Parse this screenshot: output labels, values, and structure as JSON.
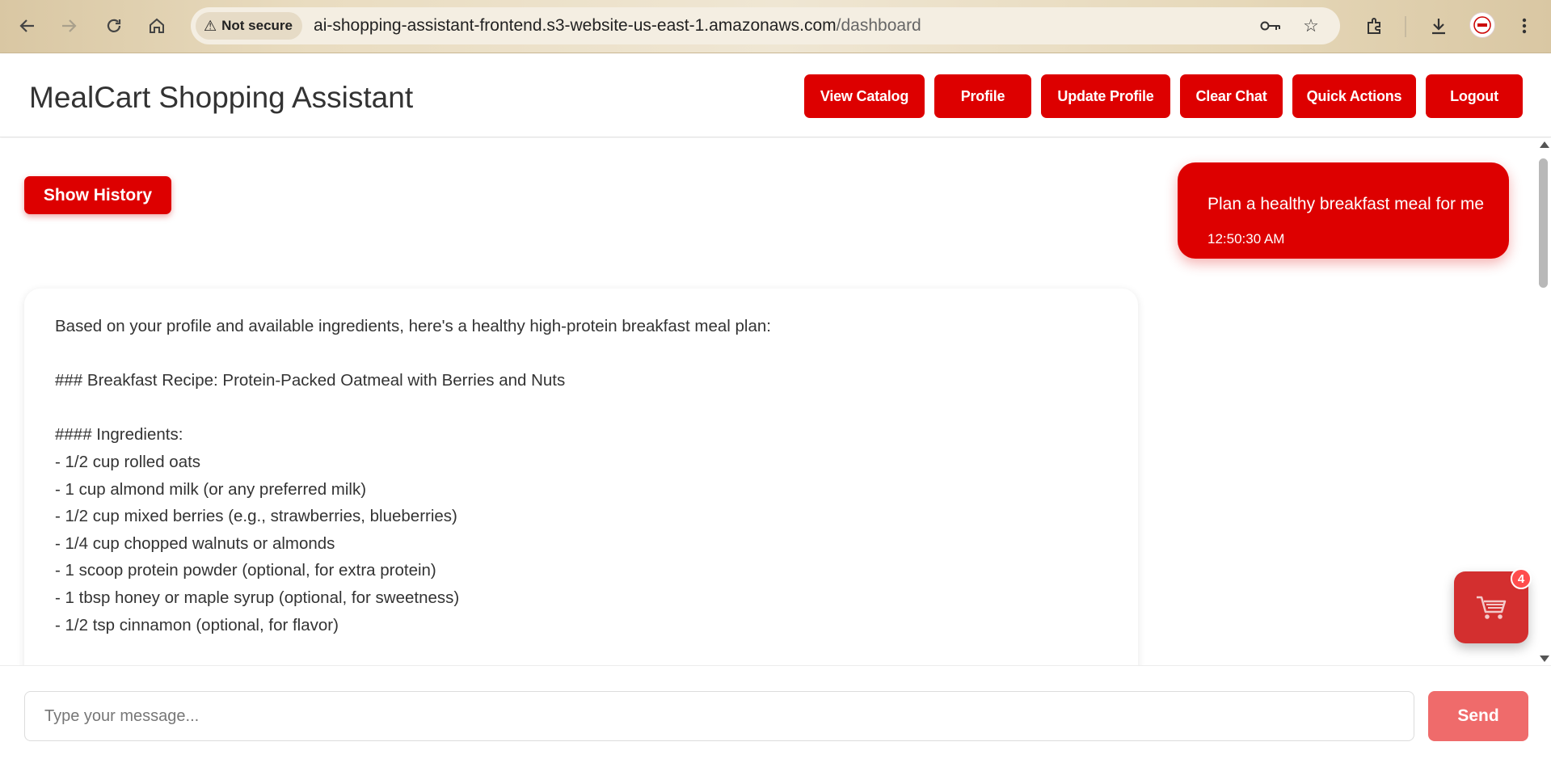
{
  "browser": {
    "security_label": "Not secure",
    "url_host": "ai-shopping-assistant-frontend.s3-website-us-east-1.amazonaws.com",
    "url_path": "/dashboard",
    "icons": [
      "back-icon",
      "forward-icon",
      "reload-icon",
      "home-icon",
      "warning-icon",
      "key-icon",
      "star-icon",
      "extensions-icon",
      "download-icon",
      "menu-icon"
    ]
  },
  "header": {
    "title": "MealCart Shopping Assistant",
    "buttons": {
      "view_catalog": "View Catalog",
      "profile": "Profile",
      "update_profile": "Update Profile",
      "clear_chat": "Clear Chat",
      "quick_actions": "Quick Actions",
      "logout": "Logout"
    }
  },
  "chat": {
    "show_history_label": "Show History",
    "user_message": {
      "text": "Plan a healthy breakfast meal for me",
      "time": "12:50:30 AM"
    },
    "bot_message": {
      "lines": [
        "Based on your profile and available ingredients, here's a healthy high-protein breakfast meal plan:",
        "",
        "### Breakfast Recipe: Protein-Packed Oatmeal with Berries and Nuts",
        "",
        "#### Ingredients:",
        "- 1/2 cup rolled oats",
        "- 1 cup almond milk (or any preferred milk)",
        "- 1/2 cup mixed berries (e.g., strawberries, blueberries)",
        "- 1/4 cup chopped walnuts or almonds",
        "- 1 scoop protein powder (optional, for extra protein)",
        "- 1 tbsp honey or maple syrup (optional, for sweetness)",
        "- 1/2 tsp cinnamon (optional, for flavor)"
      ]
    }
  },
  "cart": {
    "badge_count": "4",
    "icon": "cart-icon"
  },
  "composer": {
    "placeholder": "Type your message...",
    "value": "",
    "send_label": "Send"
  },
  "colors": {
    "accent": "#dd0000",
    "send_disabled": "#ef6b6b",
    "cart_fab": "#d32f2f"
  }
}
